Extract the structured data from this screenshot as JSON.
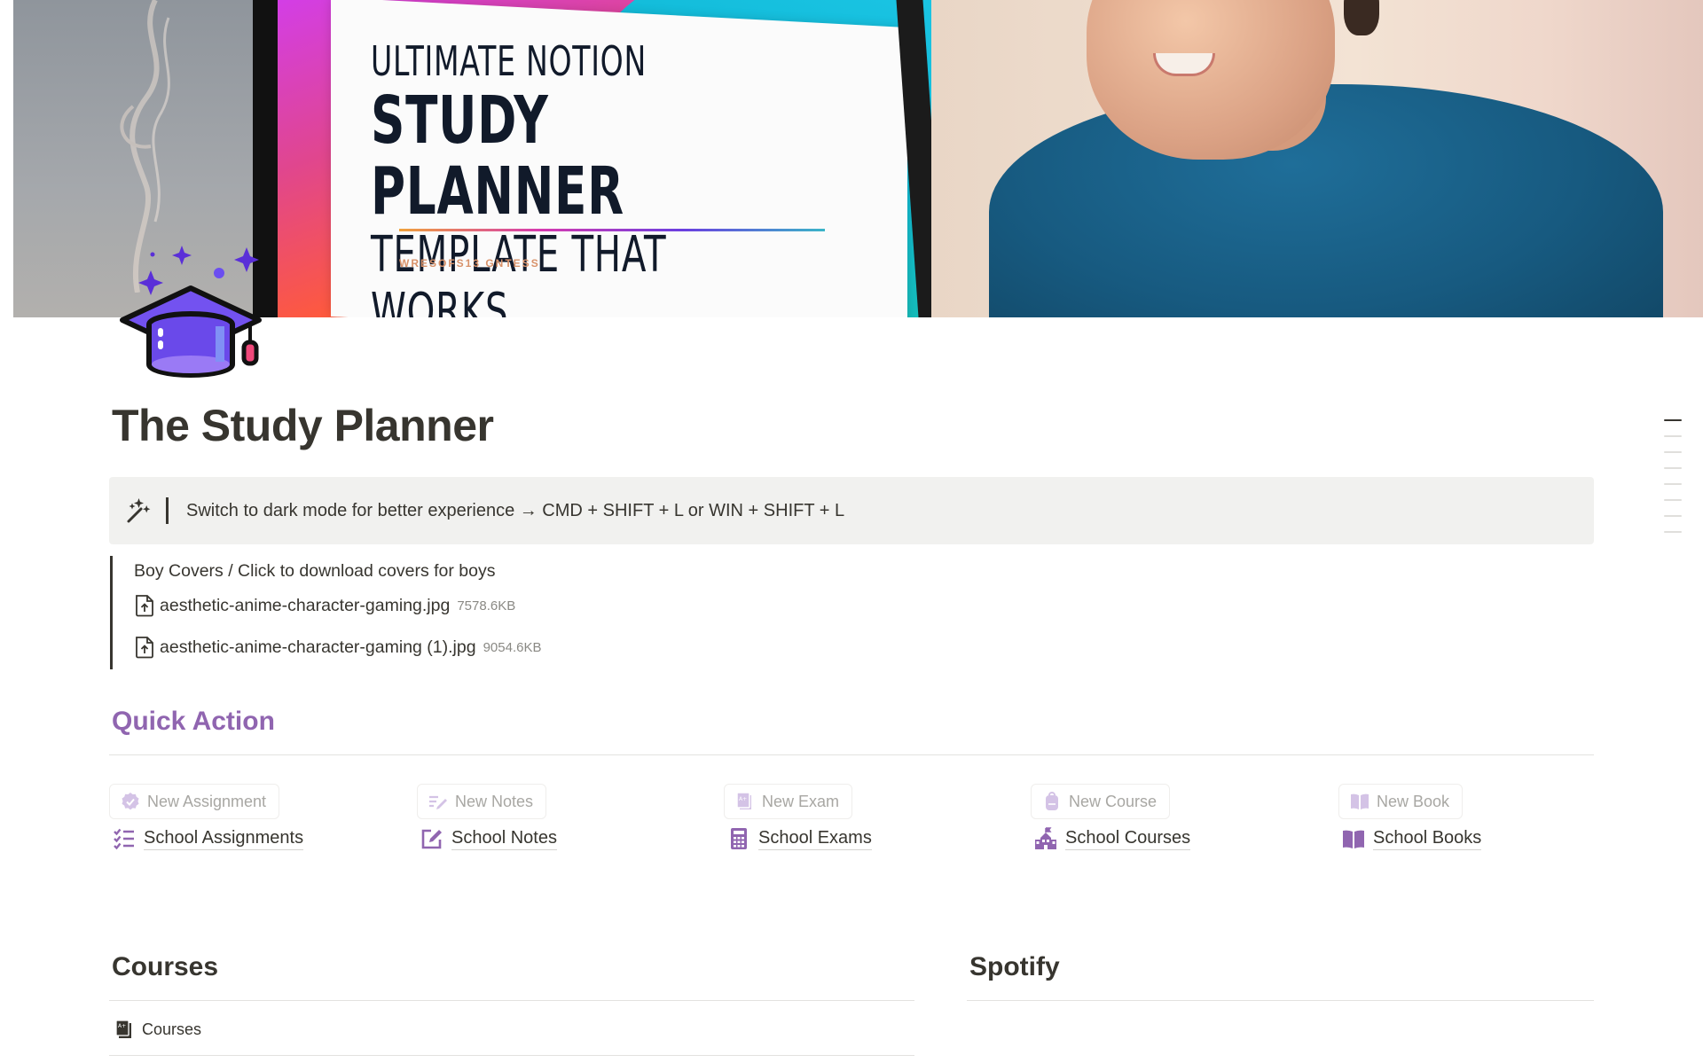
{
  "cover": {
    "headline_line1": "ULTIMATE NOTION",
    "headline_line2": "STUDY PLANNER",
    "headline_line3": "TEMPLATE THAT WORKS",
    "small_text": "WRESOFS13 GNTESS"
  },
  "page": {
    "icon": "graduation-cap-icon",
    "title": "The Study Planner"
  },
  "callout": {
    "icon": "magic-wand-icon",
    "text": "Switch to dark mode for better experience → CMD + SHIFT + L or WIN + SHIFT + L"
  },
  "quote": {
    "label": "Boy Covers / Click to download covers for boys",
    "files": [
      {
        "name": "aesthetic-anime-character-gaming.jpg",
        "size": "7578.6KB"
      },
      {
        "name": "aesthetic-anime-character-gaming (1).jpg",
        "size": "9054.6KB"
      }
    ]
  },
  "quick_action": {
    "heading": "Quick Action",
    "accent_color": "#9065b0",
    "items": [
      {
        "button": "New Assignment",
        "button_icon": "verified-badge-icon",
        "link": "School Assignments",
        "link_icon": "checklist-icon"
      },
      {
        "button": "New Notes",
        "button_icon": "write-lines-icon",
        "link": "School Notes",
        "link_icon": "edit-square-icon"
      },
      {
        "button": "New Exam",
        "button_icon": "grade-sheet-icon",
        "link": "School Exams",
        "link_icon": "calculator-icon"
      },
      {
        "button": "New Course",
        "button_icon": "backpack-icon",
        "link": "School Courses",
        "link_icon": "school-building-icon"
      },
      {
        "button": "New Book",
        "button_icon": "open-book-icon",
        "link": "School Books",
        "link_icon": "open-book-icon"
      }
    ]
  },
  "courses": {
    "heading": "Courses",
    "item_label": "Courses",
    "item_icon": "grade-sheet-icon"
  },
  "spotify": {
    "heading": "Spotify"
  },
  "toc": {
    "count": 8,
    "active_index": 0
  }
}
